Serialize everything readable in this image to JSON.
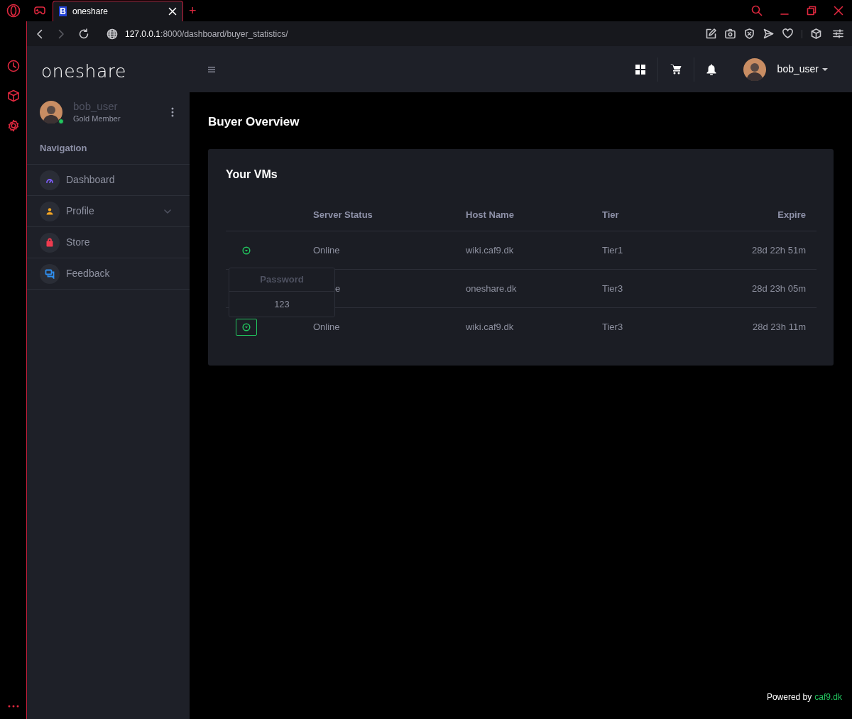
{
  "browser": {
    "tabs": [
      {
        "title": "oneshare",
        "favicon": "B",
        "selected": true
      }
    ],
    "new_tab": "+",
    "url_host": "127.0.0.1",
    "url_path": ":8000/dashboard/buyer_statistics/"
  },
  "sidebar": {
    "logo": "oneshare",
    "user": {
      "name": "bob_user",
      "role": "Gold Member",
      "online": true
    },
    "section": "Navigation",
    "items": [
      {
        "label": "Dashboard",
        "color": "#7c5cf5",
        "expandable": false
      },
      {
        "label": "Profile",
        "color": "#f5a623",
        "expandable": true
      },
      {
        "label": "Store",
        "color": "#ef3b4f",
        "expandable": false
      },
      {
        "label": "Feedback",
        "color": "#2f8ff0",
        "expandable": false
      }
    ]
  },
  "header": {
    "user": "bob_user"
  },
  "page": {
    "title": "Buyer Overview"
  },
  "card": {
    "title": "Your VMs",
    "columns": [
      "Server Status",
      "Host Name",
      "Tier",
      "Expire"
    ],
    "rows": [
      {
        "toggle": {
          "focused": false
        },
        "status": "Online",
        "host": "wiki.caf9.dk",
        "tier": "Tier1",
        "expire": "28d 22h 51m"
      },
      {
        "status": "e",
        "status_partly_hidden": true,
        "host": "oneshare.dk",
        "tier": "Tier3",
        "expire": "28d 23h 05m"
      },
      {
        "toggle": {
          "focused": true
        },
        "status": "Online",
        "host": "wiki.caf9.dk",
        "tier": "Tier3",
        "expire": "28d 23h 11m"
      }
    ],
    "popover": {
      "title": "Password",
      "value": "123"
    }
  },
  "footer": {
    "text": "Powered by",
    "link": "caf9.dk"
  }
}
